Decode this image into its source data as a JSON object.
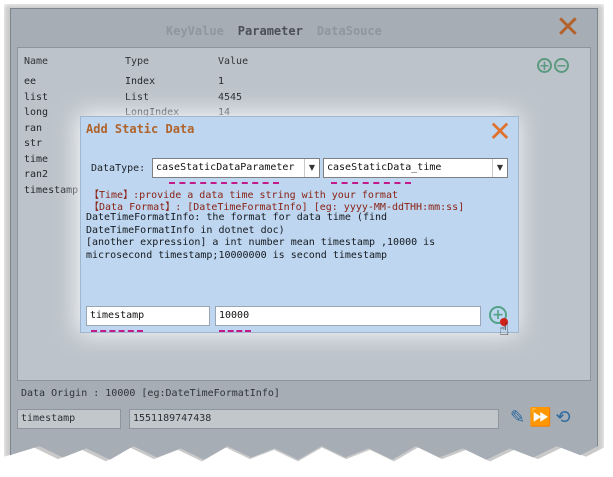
{
  "tabs": [
    {
      "label": "KeyValue",
      "active": false
    },
    {
      "label": "Parameter",
      "active": true
    },
    {
      "label": "DataSouce",
      "active": false
    }
  ],
  "table": {
    "headers": [
      "Name",
      "Type",
      "Value"
    ],
    "rows": [
      {
        "name": "ee",
        "type": "Index",
        "value": "1"
      },
      {
        "name": "list",
        "type": "List",
        "value": "4545"
      },
      {
        "name": "long",
        "type": "LongIndex",
        "value": "14"
      },
      {
        "name": "ran",
        "type": "",
        "value": ""
      },
      {
        "name": "str",
        "type": "",
        "value": ""
      },
      {
        "name": "time",
        "type": "",
        "value": ""
      },
      {
        "name": "ran2",
        "type": "",
        "value": ""
      },
      {
        "name": "timestamp",
        "type": "",
        "value": ""
      }
    ]
  },
  "data_origin": "Data Origin : 10000 [eg:DateTimeFormatInfo]",
  "bottom": {
    "name_value": "timestamp",
    "value": "1551189747438"
  },
  "dialog": {
    "title": "Add Static Data",
    "datatype_label": "DataType:",
    "select1": "caseStaticDataParameter",
    "select2": "caseStaticData_time",
    "help_line1": "【Time】:provide a data time string with your format",
    "help_line2": "【Data Format】: [DateTimeFormatInfo] [eg: yyyy-MM-ddTHH:mm:ss]",
    "help_line3": "DateTimeFormatInfo: the format for data time (find",
    "help_line4": "DateTimeFormatInfo in dotnet doc)",
    "help_line5": "[another expression] a int number mean timestamp ,10000 is",
    "help_line6": "microsecond  timestamp;10000000 is second timestamp",
    "name_input": "timestamp",
    "value_input": "10000"
  },
  "icons": {
    "close": "close-icon",
    "add": "plus-circle-icon",
    "remove": "minus-circle-icon",
    "edit": "pencil-icon",
    "run": "fast-forward-icon",
    "refresh": "refresh-icon",
    "cursor": "hand-pointer-icon"
  },
  "colors": {
    "accent_orange": "#e0722e",
    "annotation_magenta": "#c21a8a",
    "help_red": "#8a2215",
    "dialog_bg": "#bed6ef",
    "add_green": "#54a28a"
  }
}
